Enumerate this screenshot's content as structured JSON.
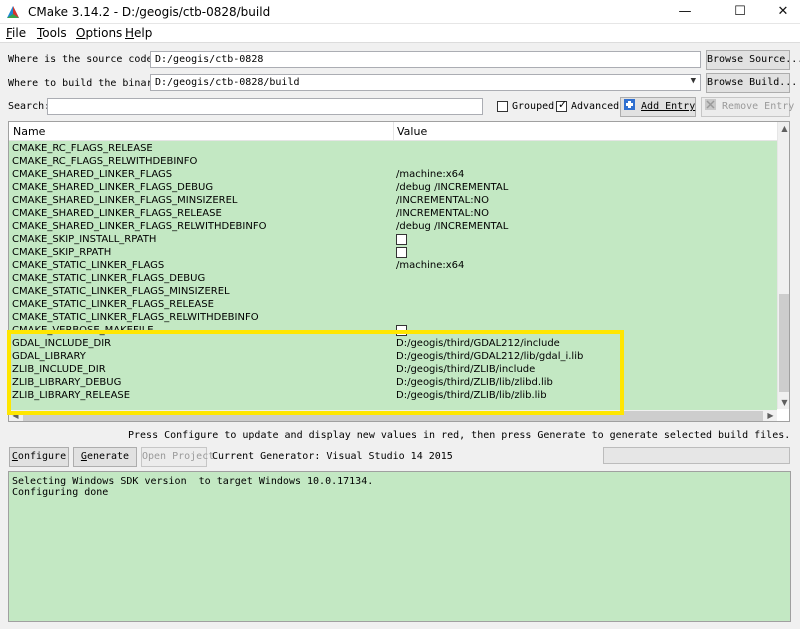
{
  "window": {
    "title": "CMake 3.14.2 - D:/geogis/ctb-0828/build",
    "minimize": "—",
    "maximize": "☐",
    "close": "✕"
  },
  "menu": [
    {
      "underlined": "F",
      "rest": "ile"
    },
    {
      "underlined": "T",
      "rest": "ools"
    },
    {
      "underlined": "O",
      "rest": "ptions"
    },
    {
      "underlined": "H",
      "rest": "elp"
    }
  ],
  "source": {
    "label": "Where is the source code:",
    "value": "D:/geogis/ctb-0828",
    "browse_label": "Browse Source..."
  },
  "build": {
    "label": "Where to build the binaries:",
    "value": "D:/geogis/ctb-0828/build",
    "browse_label": "Browse Build..."
  },
  "search": {
    "label": "Search:",
    "value": ""
  },
  "options": {
    "grouped_label": "Grouped",
    "grouped_checked": false,
    "advanced_label": "Advanced",
    "advanced_checked": true
  },
  "actions": {
    "add_entry": "Add Entry",
    "remove_entry": "Remove Entry"
  },
  "table": {
    "headers": {
      "name": "Name",
      "value": "Value"
    },
    "rows": [
      {
        "name": "CMAKE_RC_FLAGS_RELEASE",
        "value": ""
      },
      {
        "name": "CMAKE_RC_FLAGS_RELWITHDEBINFO",
        "value": ""
      },
      {
        "name": "CMAKE_SHARED_LINKER_FLAGS",
        "value": "/machine:x64"
      },
      {
        "name": "CMAKE_SHARED_LINKER_FLAGS_DEBUG",
        "value": "/debug /INCREMENTAL"
      },
      {
        "name": "CMAKE_SHARED_LINKER_FLAGS_MINSIZEREL",
        "value": "/INCREMENTAL:NO"
      },
      {
        "name": "CMAKE_SHARED_LINKER_FLAGS_RELEASE",
        "value": "/INCREMENTAL:NO"
      },
      {
        "name": "CMAKE_SHARED_LINKER_FLAGS_RELWITHDEBINFO",
        "value": "/debug /INCREMENTAL"
      },
      {
        "name": "CMAKE_SKIP_INSTALL_RPATH",
        "value": "",
        "checkbox": true
      },
      {
        "name": "CMAKE_SKIP_RPATH",
        "value": "",
        "checkbox": true
      },
      {
        "name": "CMAKE_STATIC_LINKER_FLAGS",
        "value": "/machine:x64"
      },
      {
        "name": "CMAKE_STATIC_LINKER_FLAGS_DEBUG",
        "value": ""
      },
      {
        "name": "CMAKE_STATIC_LINKER_FLAGS_MINSIZEREL",
        "value": ""
      },
      {
        "name": "CMAKE_STATIC_LINKER_FLAGS_RELEASE",
        "value": ""
      },
      {
        "name": "CMAKE_STATIC_LINKER_FLAGS_RELWITHDEBINFO",
        "value": ""
      },
      {
        "name": "CMAKE_VERBOSE_MAKEFILE",
        "value": "",
        "checkbox": true
      },
      {
        "name": "GDAL_INCLUDE_DIR",
        "value": "D:/geogis/third/GDAL212/include"
      },
      {
        "name": "GDAL_LIBRARY",
        "value": "D:/geogis/third/GDAL212/lib/gdal_i.lib"
      },
      {
        "name": "ZLIB_INCLUDE_DIR",
        "value": "D:/geogis/third/ZLIB/include"
      },
      {
        "name": "ZLIB_LIBRARY_DEBUG",
        "value": "D:/geogis/third/ZLIB/lib/zlibd.lib"
      },
      {
        "name": "ZLIB_LIBRARY_RELEASE",
        "value": "D:/geogis/third/ZLIB/lib/zlib.lib"
      }
    ]
  },
  "hint": "Press Configure to update and display new values in red, then press Generate to generate selected build files.",
  "bottom": {
    "configure_u": "C",
    "configure_rest": "onfigure",
    "generate_u": "G",
    "generate_rest": "enerate",
    "open_project": "Open Project",
    "current_generator": "Current Generator: Visual Studio 14 2015"
  },
  "output": {
    "lines": "Selecting Windows SDK version  to target Windows 10.0.17134.\nConfiguring done"
  },
  "colors": {
    "row_bg": "#c3e8c3",
    "highlight": "#ffe600"
  }
}
